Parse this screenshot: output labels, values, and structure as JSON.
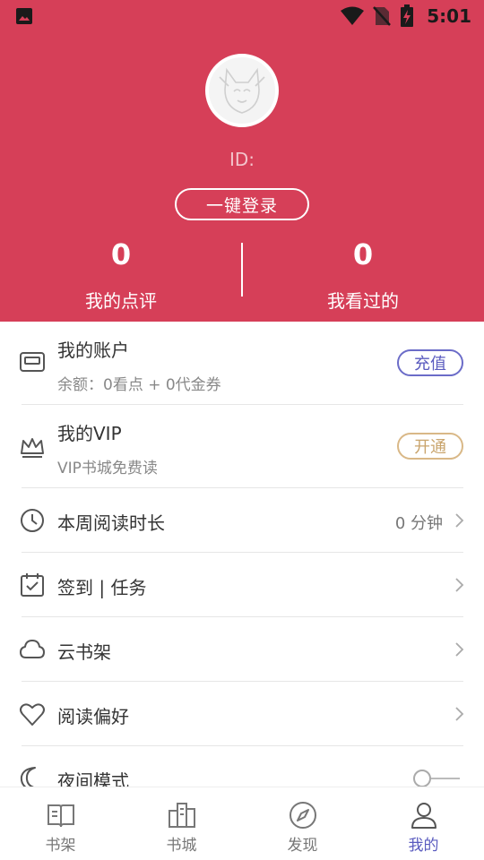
{
  "status_bar": {
    "time": "5:01"
  },
  "profile": {
    "id_label": "ID:",
    "login_button": "一键登录",
    "stats": [
      {
        "value": "0",
        "label": "我的点评"
      },
      {
        "value": "0",
        "label": "我看过的"
      }
    ]
  },
  "menu": {
    "account": {
      "title": "我的账户",
      "subtitle": "余额：0看点 + 0代金券",
      "action": "充值"
    },
    "vip": {
      "title": "我的VIP",
      "subtitle": "VIP书城免费读",
      "action": "开通"
    },
    "reading_time": {
      "title": "本周阅读时长",
      "value": "0 分钟"
    },
    "checkin": {
      "title": "签到 | 任务"
    },
    "cloud_shelf": {
      "title": "云书架"
    },
    "preferences": {
      "title": "阅读偏好"
    },
    "night_mode": {
      "title": "夜间模式",
      "enabled": false
    }
  },
  "tabs": [
    {
      "label": "书架",
      "icon": "bookshelf-icon"
    },
    {
      "label": "书城",
      "icon": "bookstore-icon"
    },
    {
      "label": "发现",
      "icon": "compass-icon"
    },
    {
      "label": "我的",
      "icon": "profile-icon",
      "active": true
    }
  ],
  "colors": {
    "header_bg": "#d63f58",
    "accent": "#5a5bbf",
    "vip_gold": "#c9a46c"
  }
}
